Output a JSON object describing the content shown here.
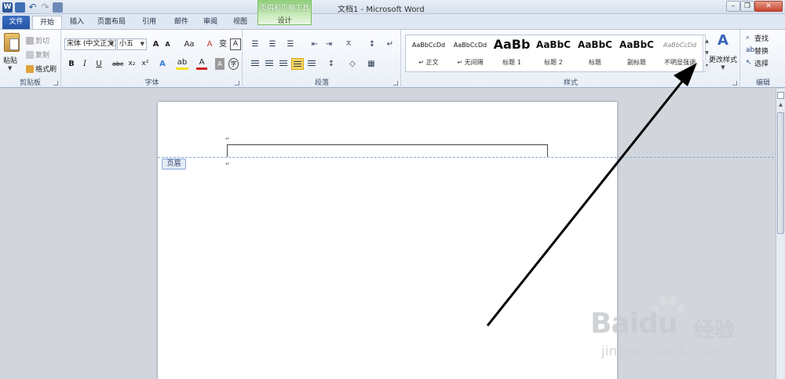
{
  "app": {
    "title": "文档1 - Microsoft Word",
    "word_icon": "W",
    "contextual_tab": {
      "title": "页眉和页脚工具",
      "design_tab": "设计"
    },
    "window_buttons": {
      "minimize": "–",
      "restore": "❐",
      "close": "✕"
    }
  },
  "ribbon": {
    "tabs": [
      "文件",
      "开始",
      "插入",
      "页面布局",
      "引用",
      "邮件",
      "审阅",
      "视图"
    ],
    "active_tab": "开始",
    "clipboard": {
      "label": "剪贴板",
      "paste": "粘贴",
      "cut": "剪切",
      "copy": "复制",
      "format_painter": "格式刷"
    },
    "font": {
      "label": "字体",
      "font_name": "宋体 (中文正文)",
      "font_size": "小五",
      "grow": "A",
      "shrink": "A",
      "change_case": "Aa",
      "clear": "A",
      "phonetic": "变",
      "char_border": "A",
      "bold": "B",
      "italic": "I",
      "underline": "U",
      "strike": "abc",
      "subscript": "x₂",
      "superscript": "x²",
      "effects": "A",
      "highlight": "ab",
      "font_color": "A",
      "char_shading": "A",
      "enclose": "字"
    },
    "paragraph": {
      "label": "段落",
      "bullets": "☰",
      "numbering": "☰",
      "multilevel": "☰",
      "dec_indent": "⇤",
      "inc_indent": "⇥",
      "asian": "ㅈ",
      "sort": "↕",
      "show_marks": "↵",
      "line_spacing": "↕",
      "shading": "◇",
      "borders": "▦"
    },
    "styles": {
      "label": "样式",
      "items": [
        {
          "preview": "AaBbCcDd",
          "name": "↵ 正文"
        },
        {
          "preview": "AaBbCcDd",
          "name": "↵ 无间隔"
        },
        {
          "preview": "AaBb",
          "name": "标题 1"
        },
        {
          "preview": "AaBbC",
          "name": "标题 2"
        },
        {
          "preview": "AaBbC",
          "name": "标题"
        },
        {
          "preview": "AaBbC",
          "name": "副标题"
        },
        {
          "preview": "AaBbCcDd",
          "name": "不明显强调"
        }
      ],
      "change_styles": "更改样式",
      "change_icon": "A"
    },
    "editing": {
      "label": "编辑",
      "find": "查找",
      "replace": "替换",
      "select": "选择"
    }
  },
  "document": {
    "header_tag": "页眉",
    "paragraph_mark": "↵"
  },
  "watermark": {
    "brand": "Bai",
    "brand2": "du",
    "cn": "经验",
    "url": "jingyan.baidu.com"
  },
  "colors": {
    "file_tab": "#2553a3",
    "contextual_tab": "#8fd07a",
    "highlight": "#f2e21b",
    "font_color": "#d21c1c",
    "arrow": "#000000"
  }
}
